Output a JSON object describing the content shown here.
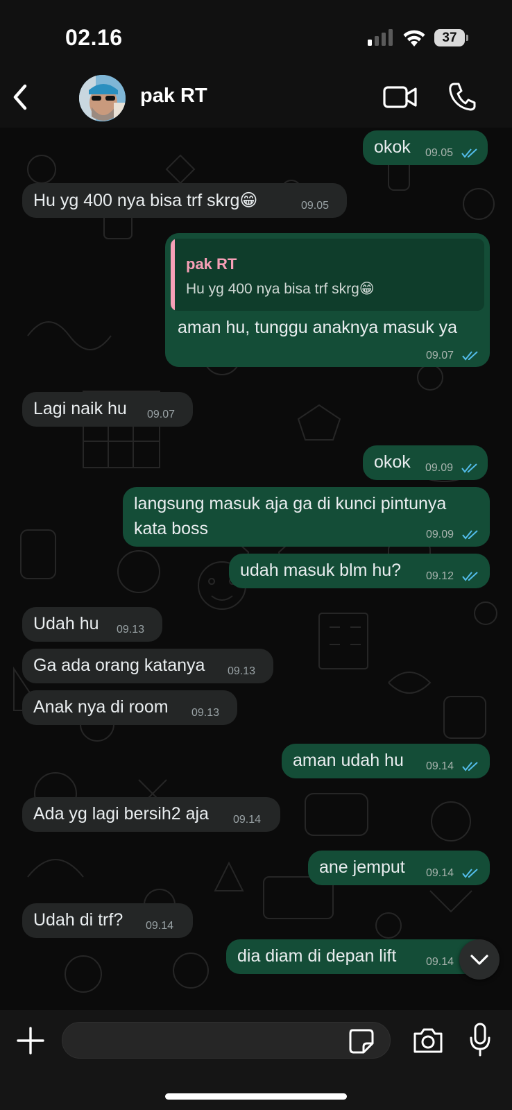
{
  "status_bar": {
    "time": "02.16",
    "battery": "37"
  },
  "header": {
    "contact_name": "pak RT"
  },
  "messages": [
    {
      "dir": "out",
      "text": "okok",
      "time": "09.05"
    },
    {
      "dir": "in",
      "text": "Hu yg 400 nya bisa trf skrg😁",
      "time": "09.05"
    },
    {
      "dir": "out",
      "reply_to": {
        "name": "pak RT",
        "text": "Hu yg 400 nya bisa trf skrg😁"
      },
      "text": "aman hu, tunggu anaknya masuk ya",
      "time": "09.07"
    },
    {
      "dir": "in",
      "text": "Lagi naik hu",
      "time": "09.07"
    },
    {
      "dir": "out",
      "text": "okok",
      "time": "09.09"
    },
    {
      "dir": "out",
      "text_line1": "langsung masuk aja ga di kunci pintunya",
      "text_line2": "kata boss",
      "time": "09.09"
    },
    {
      "dir": "out",
      "text": "udah masuk blm hu?",
      "time": "09.12"
    },
    {
      "dir": "in",
      "text": "Udah hu",
      "time": "09.13"
    },
    {
      "dir": "in",
      "text": "Ga ada orang katanya",
      "time": "09.13"
    },
    {
      "dir": "in",
      "text": "Anak nya di room",
      "time": "09.13"
    },
    {
      "dir": "out",
      "text": "aman udah hu",
      "time": "09.14"
    },
    {
      "dir": "in",
      "text": "Ada yg lagi bersih2 aja",
      "time": "09.14"
    },
    {
      "dir": "out",
      "text": "ane jemput",
      "time": "09.14"
    },
    {
      "dir": "in",
      "text": "Udah di trf?",
      "time": "09.14"
    },
    {
      "dir": "out",
      "text": "dia diam di depan lift",
      "time": "09.14"
    }
  ],
  "colors": {
    "incoming_bubble": "#242626",
    "outgoing_bubble": "#144d37",
    "read_ticks": "#53bdeb",
    "quote_accent": "#f7a0b7"
  },
  "icons": [
    "back-chevron-icon",
    "video-call-icon",
    "phone-icon",
    "chevron-down-icon",
    "plus-icon",
    "sticker-icon",
    "camera-icon",
    "microphone-icon"
  ]
}
